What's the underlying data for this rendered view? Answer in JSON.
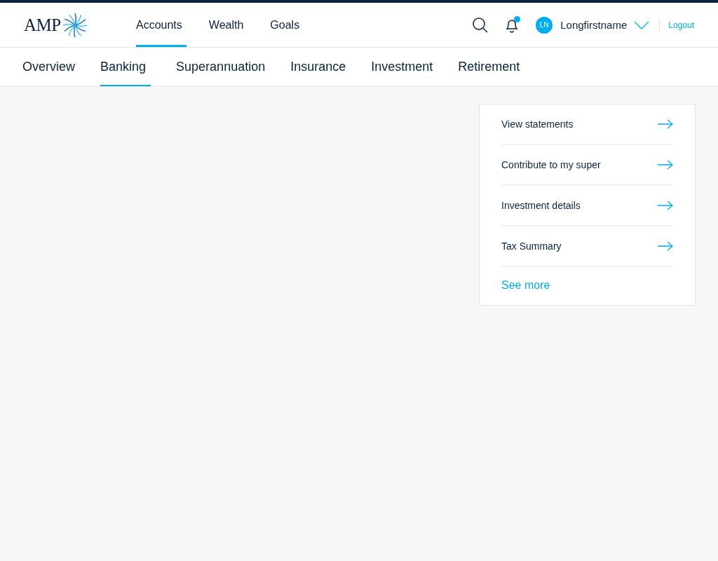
{
  "header": {
    "logo": "AMP",
    "nav": [
      {
        "label": "Accounts",
        "selected": true
      },
      {
        "label": "Wealth",
        "selected": false
      },
      {
        "label": "Goals",
        "selected": false
      }
    ],
    "notifications": {
      "unread": true
    },
    "user": {
      "initials": "LN",
      "name": "Longfirstname"
    },
    "logout": "Logout"
  },
  "subnav": [
    {
      "label": "Overview",
      "selected": false
    },
    {
      "label": "Banking",
      "selected": true
    },
    {
      "label": "Superannuation",
      "selected": false
    },
    {
      "label": "Insurance",
      "selected": false
    },
    {
      "label": "Investment",
      "selected": false
    },
    {
      "label": "Retirement",
      "selected": false
    }
  ],
  "quick_links": {
    "items": [
      "View statements",
      "Contribute to my super",
      "Investment details",
      "Tax Summary"
    ],
    "more": "See more"
  }
}
